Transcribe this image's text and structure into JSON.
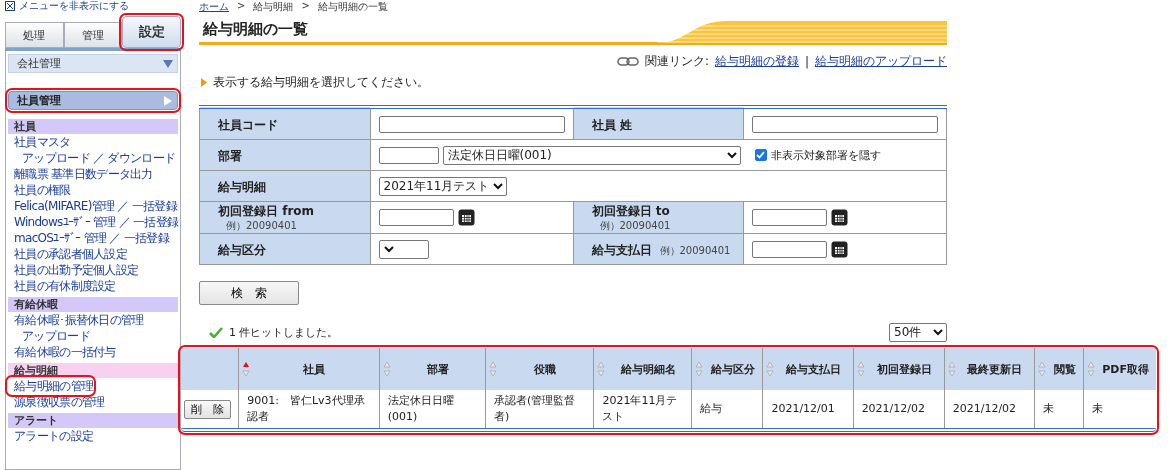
{
  "menu_toggle": {
    "label": "メニューを非表示にする"
  },
  "sidebar": {
    "tabs": [
      {
        "label": "処理",
        "selected": false,
        "highlighted": false
      },
      {
        "label": "管理",
        "selected": false,
        "highlighted": false
      },
      {
        "label": "設定",
        "selected": true,
        "highlighted": true
      }
    ],
    "menus": [
      {
        "label": "会社管理",
        "selected": false,
        "highlighted": false
      },
      {
        "label": "社員管理",
        "selected": true,
        "highlighted": true
      }
    ],
    "sections": [
      {
        "title": "社員",
        "color": "#d4c8f8",
        "items": [
          {
            "label": "社員マスタ",
            "highlighted": false,
            "children": [
              {
                "label": "アップロード ／ ダウンロード",
                "highlighted": false
              }
            ]
          },
          {
            "label": "離職票 基準日数データ出力",
            "highlighted": false
          },
          {
            "label": "社員の権限",
            "highlighted": false
          },
          {
            "label": "Felica(MIFARE)管理 ／ 一括登録",
            "highlighted": false
          },
          {
            "label": "Windowsﾕｰｻﾞｰ 管理 ／ 一括登録",
            "highlighted": false
          },
          {
            "label": "macOSﾕｰｻﾞｰ 管理 ／ 一括登録",
            "highlighted": false
          },
          {
            "label": "社員の承認者個人設定",
            "highlighted": false
          },
          {
            "label": "社員の出勤予定個人設定",
            "highlighted": false
          },
          {
            "label": "社員の有休制度設定",
            "highlighted": false
          }
        ]
      },
      {
        "title": "有給休暇",
        "color": "#d4c8f8",
        "items": [
          {
            "label": "有給休暇･振替休日の管理",
            "highlighted": false,
            "children": [
              {
                "label": "アップロード",
                "highlighted": false
              }
            ]
          },
          {
            "label": "有給休暇の一括付与",
            "highlighted": false
          }
        ]
      },
      {
        "title": "給与明細",
        "color": "#f8d0f0",
        "items": [
          {
            "label": "給与明細の管理",
            "highlighted": true
          },
          {
            "label": "源泉徴収票の管理",
            "highlighted": false
          }
        ]
      },
      {
        "title": "アラート",
        "color": "#d4c8f8",
        "items": [
          {
            "label": "アラートの設定",
            "highlighted": false
          }
        ]
      }
    ]
  },
  "breadcrumb": {
    "separator": ">",
    "items": [
      "ホーム",
      "給与明細",
      "給与明細の一覧"
    ]
  },
  "page_title": "給与明細の一覧",
  "related_links": {
    "label": "関連リンク:",
    "separator": "|",
    "links": [
      "給与明細の登録",
      "給与明細のアップロード"
    ]
  },
  "instruction": "表示する給与明細を選択してください。",
  "search_form": {
    "rows": [
      [
        {
          "kind": "label",
          "text": "社員コード"
        },
        {
          "kind": "value",
          "controls": [
            {
              "kind": "text"
            }
          ]
        },
        {
          "kind": "label",
          "text": "社員 姓"
        },
        {
          "kind": "value",
          "controls": [
            {
              "kind": "text"
            }
          ]
        }
      ],
      [
        {
          "kind": "label",
          "text": "部署"
        },
        {
          "kind": "value",
          "colspan": 3,
          "controls": [
            {
              "kind": "code"
            },
            {
              "kind": "select_wide",
              "value": "法定休日日曜(001)"
            },
            {
              "kind": "checkbox",
              "label": "非表示対象部署を隠す",
              "checked": true
            }
          ]
        }
      ],
      [
        {
          "kind": "label",
          "text": "給与明細"
        },
        {
          "kind": "value",
          "colspan": 3,
          "controls": [
            {
              "kind": "select",
              "value": "2021年11月テスト"
            }
          ]
        }
      ],
      [
        {
          "kind": "label",
          "text": "初回登録日 from",
          "hint": "例）20090401"
        },
        {
          "kind": "value",
          "controls": [
            {
              "kind": "date"
            }
          ]
        },
        {
          "kind": "label",
          "text": "初回登録日 to",
          "hint": "例）20090401"
        },
        {
          "kind": "value",
          "controls": [
            {
              "kind": "date"
            }
          ]
        }
      ],
      [
        {
          "kind": "label",
          "text": "給与区分"
        },
        {
          "kind": "value",
          "controls": [
            {
              "kind": "select"
            }
          ]
        },
        {
          "kind": "label",
          "text": "給与支払日",
          "hint": "例）20090401"
        },
        {
          "kind": "value",
          "controls": [
            {
              "kind": "date"
            }
          ]
        }
      ]
    ]
  },
  "search_button": "検　索",
  "result": {
    "message": "1 件ヒットしました。",
    "page_size": "50件"
  },
  "results_table": {
    "highlighted": true,
    "columns": [
      {
        "label": "社員",
        "sorted": true
      },
      {
        "label": "部署",
        "sorted": false
      },
      {
        "label": "役職",
        "sorted": false
      },
      {
        "label": "給与明細名",
        "sorted": false
      },
      {
        "label": "給与区分",
        "sorted": false
      },
      {
        "label": "給与支払日",
        "sorted": false
      },
      {
        "label": "初回登録日",
        "sorted": false
      },
      {
        "label": "最終更新日",
        "sorted": false
      },
      {
        "label": "閲覧",
        "sorted": false
      },
      {
        "label": "PDF取得",
        "sorted": false
      }
    ],
    "rows": [
      {
        "action": "削　除",
        "cells": [
          "9001:　皆仁Lv3代理承認者",
          "法定休日日曜(001)",
          "承認者(管理監督者)",
          "2021年11月テスト",
          "給与",
          "2021/12/01",
          "2021/12/02",
          "2021/12/02",
          "未",
          "未"
        ]
      }
    ]
  }
}
